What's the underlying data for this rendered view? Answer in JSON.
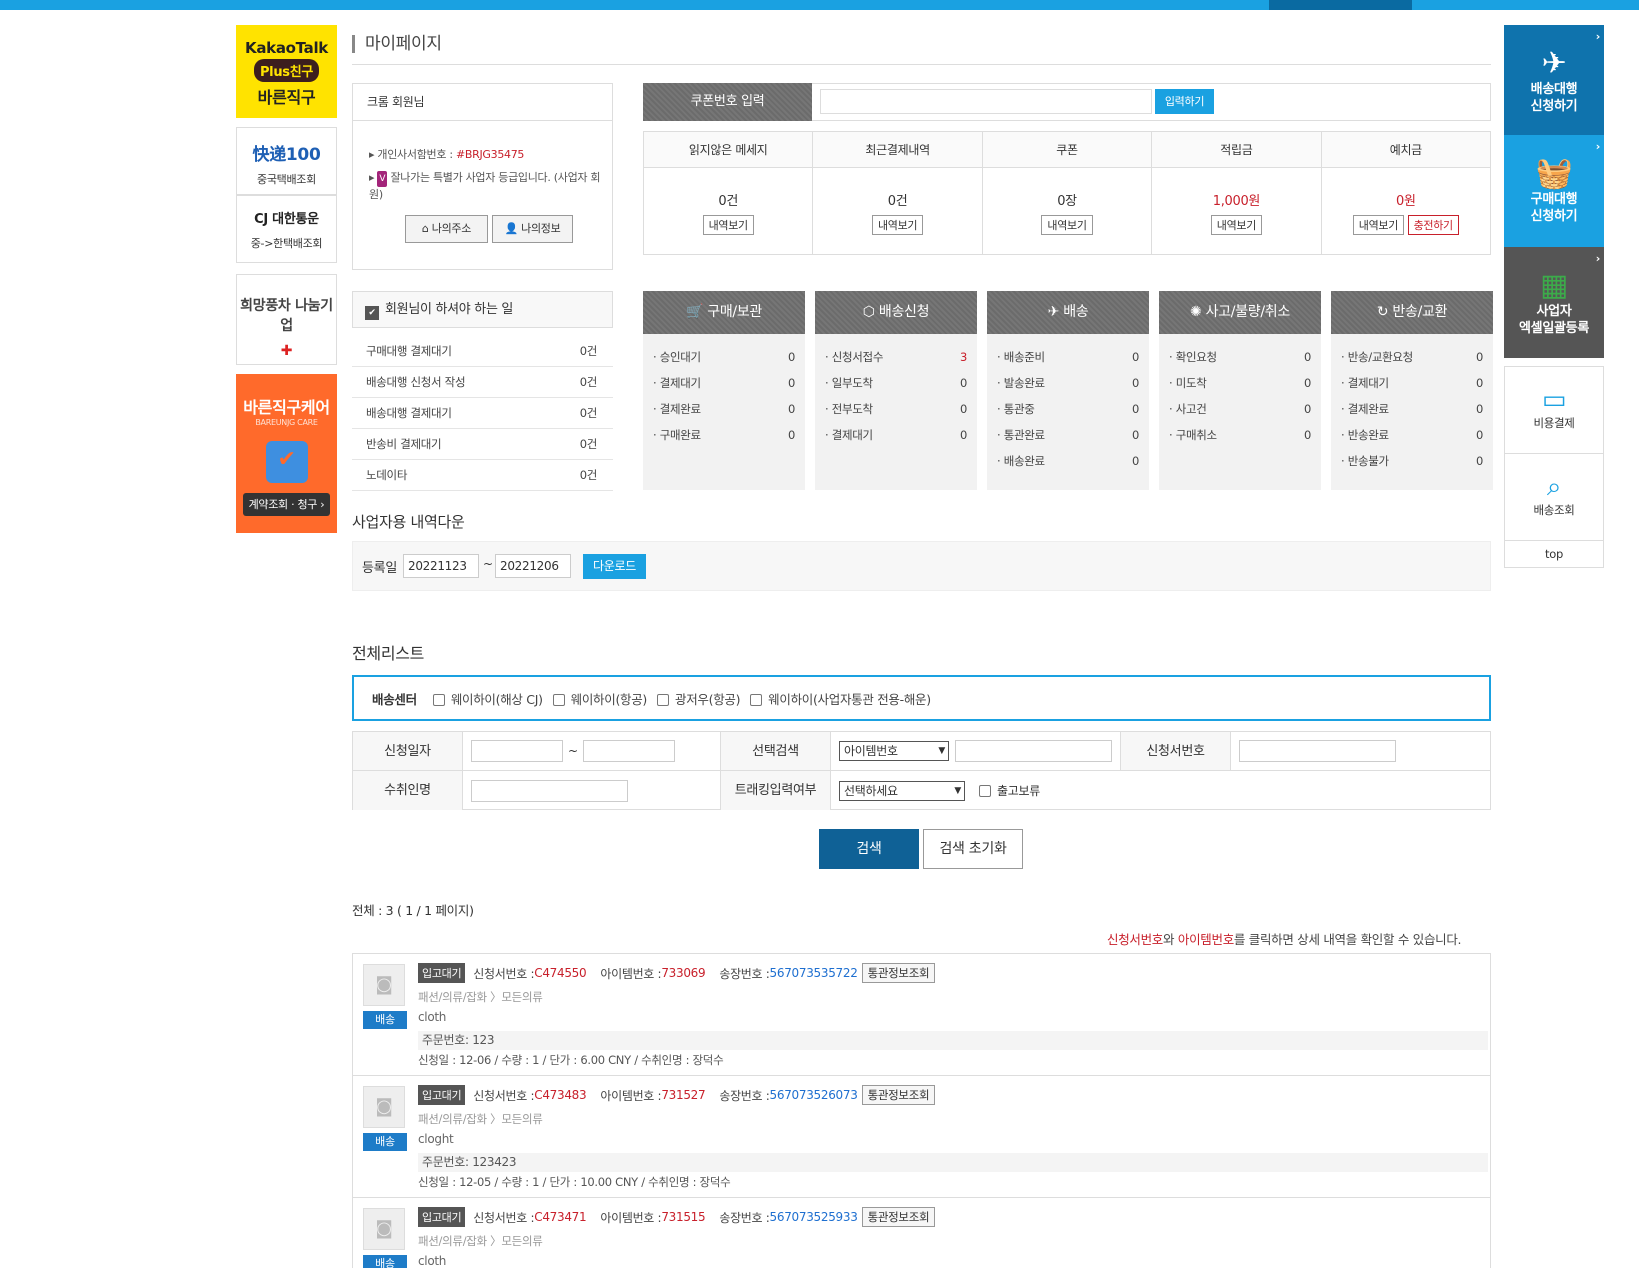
{
  "left_banners": {
    "kakao": {
      "line1": "KakaoTalk",
      "line2": "Plus친구",
      "line3": "바른직구"
    },
    "kuaidi": {
      "logo": "快递100",
      "label": "중국택배조회"
    },
    "cj": {
      "logo": "CJ 대한통운",
      "label": "중->한택배조회"
    },
    "hope": {
      "logo": "희망풍차 나눔기업"
    },
    "care": {
      "title": "바른직구케어",
      "sub": "BAREUNJG CARE",
      "button": "계약조회 · 청구 ›"
    }
  },
  "page_title": "마이페이지",
  "member": {
    "name": "크롬 회원님",
    "code_label": "개인사서함번호 : ",
    "code": "#BRJG35475",
    "grade": "잘나가는 특별가 사업자 등급입니다. (사업자 회원)",
    "btn_address": "나의주소",
    "btn_info": "나의정보"
  },
  "coupon": {
    "label": "쿠폰번호 입력",
    "button": "입력하기",
    "value": ""
  },
  "stats": [
    {
      "title": "읽지않은 메세지",
      "value": "0건",
      "btn": "내역보기"
    },
    {
      "title": "최근결제내역",
      "value": "0건",
      "btn": "내역보기"
    },
    {
      "title": "쿠폰",
      "value": "0장",
      "btn": "내역보기"
    },
    {
      "title": "적립금",
      "value": "1,000원",
      "btn": "내역보기"
    },
    {
      "title": "예치금",
      "value": "0원",
      "btn": "내역보기",
      "btn2": "충전하기"
    }
  ],
  "todo": {
    "title": "회원님이 하셔야 하는 일",
    "rows": [
      {
        "label": "구매대행 결제대기",
        "count": "0건"
      },
      {
        "label": "배송대행 신청서 작성",
        "count": "0건"
      },
      {
        "label": "배송대행 결제대기",
        "count": "0건"
      },
      {
        "label": "반송비 결제대기",
        "count": "0건"
      },
      {
        "label": "노데이타",
        "count": "0건"
      }
    ]
  },
  "columns": [
    {
      "title": "구매/보관",
      "icon": "🛒",
      "rows": [
        {
          "l": "· 승인대기",
          "n": "0"
        },
        {
          "l": "· 결제대기",
          "n": "0"
        },
        {
          "l": "· 결제완료",
          "n": "0"
        },
        {
          "l": "· 구매완료",
          "n": "0"
        }
      ]
    },
    {
      "title": "배송신청",
      "icon": "⬡",
      "rows": [
        {
          "l": "· 신청서접수",
          "n": "3"
        },
        {
          "l": "· 일부도착",
          "n": "0"
        },
        {
          "l": "· 전부도착",
          "n": "0"
        },
        {
          "l": "· 결제대기",
          "n": "0"
        }
      ]
    },
    {
      "title": "배송",
      "icon": "✈",
      "rows": [
        {
          "l": "· 배송준비",
          "n": "0"
        },
        {
          "l": "· 발송완료",
          "n": "0"
        },
        {
          "l": "· 통관중",
          "n": "0"
        },
        {
          "l": "· 통관완료",
          "n": "0"
        },
        {
          "l": "· 배송완료",
          "n": "0"
        }
      ]
    },
    {
      "title": "사고/불량/취소",
      "icon": "✺",
      "rows": [
        {
          "l": "· 확인요청",
          "n": "0"
        },
        {
          "l": "· 미도착",
          "n": "0"
        },
        {
          "l": "· 사고건",
          "n": "0"
        },
        {
          "l": "· 구매취소",
          "n": "0"
        }
      ]
    },
    {
      "title": "반송/교환",
      "icon": "↻",
      "rows": [
        {
          "l": "· 반송/교환요청",
          "n": "0"
        },
        {
          "l": "· 결제대기",
          "n": "0"
        },
        {
          "l": "· 결제완료",
          "n": "0"
        },
        {
          "l": "· 반송완료",
          "n": "0"
        },
        {
          "l": "· 반송불가",
          "n": "0"
        }
      ]
    }
  ],
  "right_quick": {
    "ship": "배송대행\n신청하기",
    "buy": "구매대행\n신청하기",
    "excel": "사업자\n엑셀일괄등록",
    "pay": "비용결제",
    "track": "배송조회",
    "top": "top"
  },
  "download": {
    "title": "사업자용 내역다운",
    "label": "등록일",
    "from": "20221123",
    "tilde": "~",
    "to": "20221206",
    "button": "다운로드"
  },
  "list": {
    "title": "전체리스트",
    "centers_label": "배송센터",
    "centers": [
      "웨이하이(해상 CJ)",
      "웨이하이(항공)",
      "광저우(항공)",
      "웨이하이(사업자통관 전용-해운)"
    ],
    "form": {
      "date_label": "신청일자",
      "tilde": "~",
      "select_label": "선택검색",
      "select_value": "아이템번호",
      "appno_label": "신청서번호",
      "recv_label": "수취인명",
      "track_label": "트래킹입력여부",
      "track_value": "선택하세요",
      "hold_label": "출고보류"
    },
    "search_btn": "검색",
    "reset_btn": "검색 초기화",
    "total": "전체 : 3 ( 1 / 1 페이지)",
    "notice_a": "신청서번호",
    "notice_b": "와 ",
    "notice_c": "아이템번호",
    "notice_d": "를 클릭하면 상세 내역을 확인할 수 있습니다.",
    "items": [
      {
        "status": "입고대기",
        "app_label": "신청서번호 : ",
        "app": "C474550",
        "item_label": "아이템번호 : ",
        "item": "733069",
        "inv_label": "송장번호 : ",
        "inv": "567073535722",
        "btn": "통관정보조회",
        "cat": "패션/의류/잡화 〉모든의류",
        "tag": "배송",
        "name": "cloth",
        "order": "주문번호: 123",
        "meta": "신청일 : 12-06 / 수량 : 1 / 단가 : 6.00 CNY / 수취인명 : 장덕수"
      },
      {
        "status": "입고대기",
        "app_label": "신청서번호 : ",
        "app": "C473483",
        "item_label": "아이템번호 : ",
        "item": "731527",
        "inv_label": "송장번호 : ",
        "inv": "567073526073",
        "btn": "통관정보조회",
        "cat": "패션/의류/잡화 〉모든의류",
        "tag": "배송",
        "name": "cloght",
        "order": "주문번호: 123423",
        "meta": "신청일 : 12-05 / 수량 : 1 / 단가 : 10.00 CNY / 수취인명 : 장덕수"
      },
      {
        "status": "입고대기",
        "app_label": "신청서번호 : ",
        "app": "C473471",
        "item_label": "아이템번호 : ",
        "item": "731515",
        "inv_label": "송장번호 : ",
        "inv": "567073525933",
        "btn": "통관정보조회",
        "cat": "패션/의류/잡화 〉모든의류",
        "tag": "배송",
        "name": "cloth",
        "order": "",
        "meta": ""
      }
    ]
  },
  "colors": {
    "accent": "#1aa1e1",
    "dark_blue": "#0f6196",
    "red": "#c8202b",
    "link_blue": "#1e6fd0"
  }
}
